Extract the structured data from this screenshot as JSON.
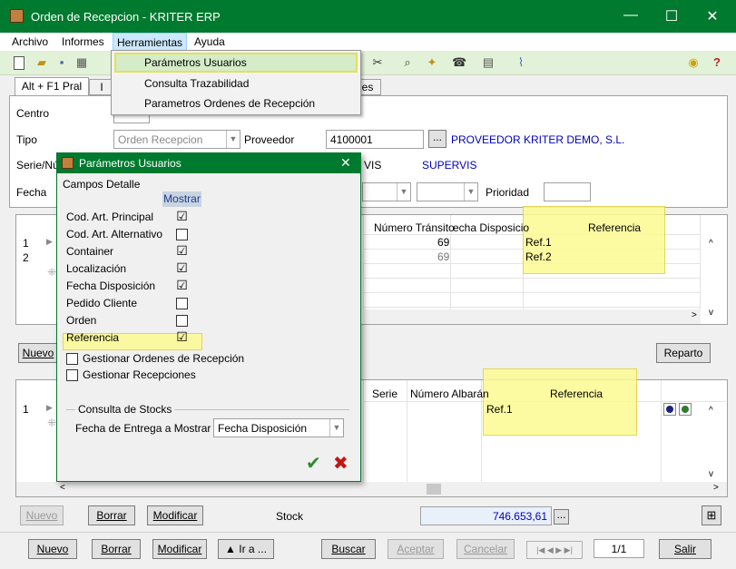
{
  "window": {
    "title": "Orden de Recepcion - KRITER ERP",
    "min": "—",
    "max": "☐",
    "close": "✕"
  },
  "menu": {
    "items": [
      "Archivo",
      "Informes",
      "Herramientas",
      "Ayuda"
    ]
  },
  "dropdown": {
    "items": [
      "Parámetros Usuarios",
      "Consulta Trazabilidad",
      "Parametros Ordenes de Recepción"
    ]
  },
  "tabs": {
    "main": "Alt + F1 Pral",
    "b": "I",
    "c": "es"
  },
  "form": {
    "centro_label": "Centro",
    "centro_value": "",
    "tipo_label": "Tipo",
    "tipo_value": "Orden Recepcion",
    "proveedor_label": "Proveedor",
    "proveedor_code": "4100001",
    "proveedor_name": "PROVEEDOR KRITER DEMO, S.L.",
    "serie_label": "Serie/Nú",
    "serie_value": "VIS",
    "serie_name": "SUPERVIS",
    "fecha_label": "Fecha",
    "prioridad_label": "Prioridad",
    "prioridad_value": ""
  },
  "grid1": {
    "headers": {
      "transito": "Número Tránsito",
      "fecha": "echa Disposicio",
      "ref": "Referencia"
    },
    "rows": [
      {
        "n": "1",
        "transito": "69",
        "ref": "Ref.1"
      },
      {
        "n": "2",
        "transito": "69",
        "ref": "Ref.2"
      }
    ],
    "new_row_marker": "⁜"
  },
  "grid2": {
    "headers": {
      "serie": "Serie",
      "albaran": "Número Albarán",
      "ref": "Referencia"
    },
    "rows": [
      {
        "n": "1",
        "ref": "Ref.1"
      }
    ]
  },
  "buttons": {
    "nuevo_top": "Nuevo",
    "reparto": "Reparto",
    "nuevo_mid": "Nuevo",
    "borrar_mid": "Borrar",
    "modificar_mid": "Modificar",
    "stock_label": "Stock",
    "stock_value": "746.653,61",
    "more": "...",
    "nuevo": "Nuevo",
    "borrar": "Borrar",
    "modificar": "Modificar",
    "ira": "▲ Ir a ...",
    "buscar": "Buscar",
    "aceptar": "Aceptar",
    "cancelar": "Cancelar",
    "page": "1/1",
    "salir": "Salir"
  },
  "dialog": {
    "title": "Parámetros Usuarios",
    "close": "✕",
    "group": "Campos Detalle",
    "col_header": "Mostrar",
    "fields": [
      {
        "label": "Cod. Art. Principal",
        "checked": "☑"
      },
      {
        "label": "Cod. Art. Alternativo",
        "checked": ""
      },
      {
        "label": "Container",
        "checked": "☑"
      },
      {
        "label": "Localización",
        "checked": "☑"
      },
      {
        "label": "Fecha Disposición",
        "checked": "☑"
      },
      {
        "label": "Pedido Cliente",
        "checked": ""
      },
      {
        "label": "Orden",
        "checked": ""
      },
      {
        "label": "Referencia",
        "checked": "☑"
      }
    ],
    "gestionar_ordenes": "Gestionar Ordenes de Recepción",
    "gestionar_recepciones": "Gestionar Recepciones",
    "stocks_group": "Consulta de Stocks",
    "fecha_entrega_label": "Fecha de Entrega a Mostrar",
    "fecha_entrega_value": "Fecha Disposición",
    "ok": "✔",
    "cancel": "✖"
  },
  "colors": {
    "title_bar": "#007a2e",
    "accent_blue": "#0000c0",
    "highlight": "#fdfb91"
  }
}
